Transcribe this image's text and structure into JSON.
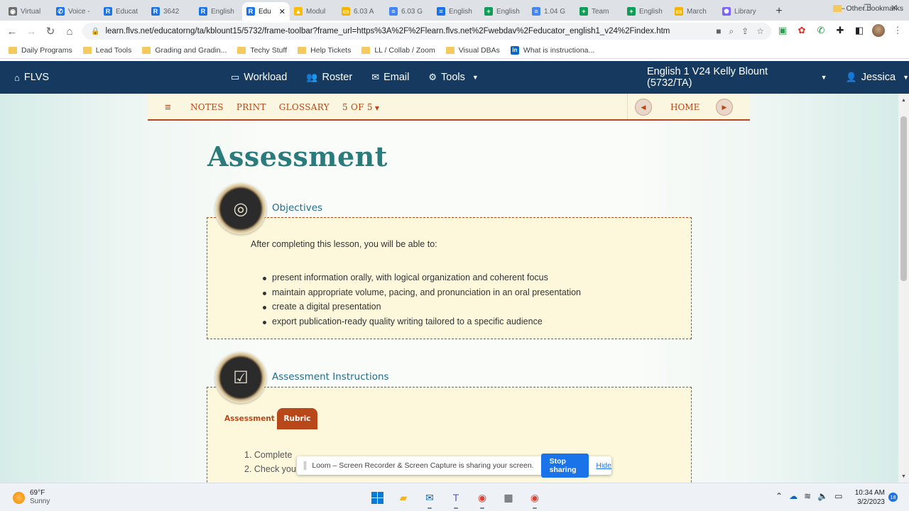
{
  "browser": {
    "tabs": [
      {
        "label": "Virtual",
        "color": "#6e6e6e",
        "glyph": "◉"
      },
      {
        "label": "Voice -",
        "color": "#1a73e8",
        "glyph": "✆"
      },
      {
        "label": "Educat",
        "color": "#1a73e8",
        "glyph": "R"
      },
      {
        "label": "3642",
        "color": "#1a73e8",
        "glyph": "R"
      },
      {
        "label": "English",
        "color": "#1a73e8",
        "glyph": "R"
      },
      {
        "label": "Edu",
        "color": "#1a73e8",
        "glyph": "R",
        "active": true
      },
      {
        "label": "Modul",
        "color": "#fbbc04",
        "glyph": "▲"
      },
      {
        "label": "6.03 A",
        "color": "#f4b400",
        "glyph": "▭"
      },
      {
        "label": "6.03 G",
        "color": "#4285f4",
        "glyph": "≡"
      },
      {
        "label": "English",
        "color": "#1a73e8",
        "glyph": "≡"
      },
      {
        "label": "English",
        "color": "#0f9d58",
        "glyph": "+"
      },
      {
        "label": "1.04 G",
        "color": "#4285f4",
        "glyph": "≡"
      },
      {
        "label": "Team",
        "color": "#0f9d58",
        "glyph": "+"
      },
      {
        "label": "English",
        "color": "#0f9d58",
        "glyph": "+"
      },
      {
        "label": "March",
        "color": "#f4b400",
        "glyph": "▭"
      },
      {
        "label": "Library",
        "color": "#7b61ff",
        "glyph": "✺"
      }
    ],
    "url": "learn.flvs.net/educatorng/ta/kblount15/5732/frame-toolbar?frame_url=https%3A%2F%2Flearn.flvs.net%2Fwebdav%2Feducator_english1_v24%2Findex.htm",
    "bookmarks": [
      {
        "label": "Daily Programs",
        "type": "folder"
      },
      {
        "label": "Lead Tools",
        "type": "folder"
      },
      {
        "label": "Grading and Gradin...",
        "type": "folder"
      },
      {
        "label": "Techy Stuff",
        "type": "folder"
      },
      {
        "label": "Help Tickets",
        "type": "folder"
      },
      {
        "label": "LL / Collab / Zoom",
        "type": "folder"
      },
      {
        "label": "Visual DBAs",
        "type": "folder"
      },
      {
        "label": "What is instructiona...",
        "type": "linkedin"
      }
    ],
    "other_bookmarks": "Other bookmarks"
  },
  "flvs_nav": {
    "home": "FLVS",
    "items": [
      "Workload",
      "Roster",
      "Email",
      "Tools"
    ],
    "course": "English 1 V24 Kelly Blount (5732/TA)",
    "user": "Jessica"
  },
  "lesson_bar": {
    "links": [
      "NOTES",
      "PRINT",
      "GLOSSARY",
      "5 OF 5"
    ],
    "home": "HOME"
  },
  "page": {
    "title": "Assessment",
    "objectives": {
      "heading": "Objectives",
      "intro": "After completing this lesson, you will be able to:",
      "items": [
        "present information orally, with logical organization and coherent focus",
        "maintain appropriate volume, pacing, and pronunciation in an oral presentation",
        "create a digital presentation",
        "export publication-ready quality writing tailored to a specific audience"
      ]
    },
    "instructions": {
      "heading": "Assessment Instructions",
      "tab_assessment": "Assessment",
      "tab_rubric": "Rubric",
      "steps": [
        "1. Complete",
        "2. Check you"
      ]
    }
  },
  "loom": {
    "message": "Loom – Screen Recorder & Screen Capture is sharing your screen.",
    "stop": "Stop sharing",
    "hide": "Hide"
  },
  "taskbar": {
    "temp": "69°F",
    "condition": "Sunny",
    "time": "10:34 AM",
    "date": "3/2/2023",
    "notifications": "18"
  }
}
